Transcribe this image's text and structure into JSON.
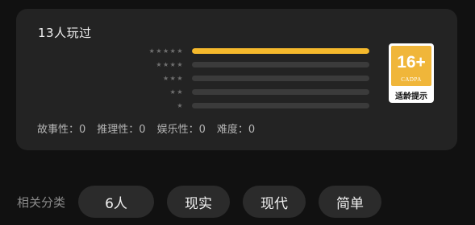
{
  "summary": {
    "players_text": "13人玩过"
  },
  "ratings": [
    {
      "stars": "★★★★★",
      "fraction": 1.0
    },
    {
      "stars": "★★★★",
      "fraction": 0.0
    },
    {
      "stars": "★★★",
      "fraction": 0.0
    },
    {
      "stars": "★★",
      "fraction": 0.0
    },
    {
      "stars": "★",
      "fraction": 0.0
    }
  ],
  "age_rating": {
    "number": "16+",
    "org": "CADPA",
    "caption": "适龄提示",
    "color": "#f0b63a"
  },
  "attributes": [
    {
      "text": "故事性：0"
    },
    {
      "text": "推理性：0"
    },
    {
      "text": "娱乐性：0"
    },
    {
      "text": "难度：0"
    }
  ],
  "categories": {
    "label": "相关分类",
    "chips": [
      "6人",
      "现实",
      "现代",
      "简单"
    ]
  }
}
